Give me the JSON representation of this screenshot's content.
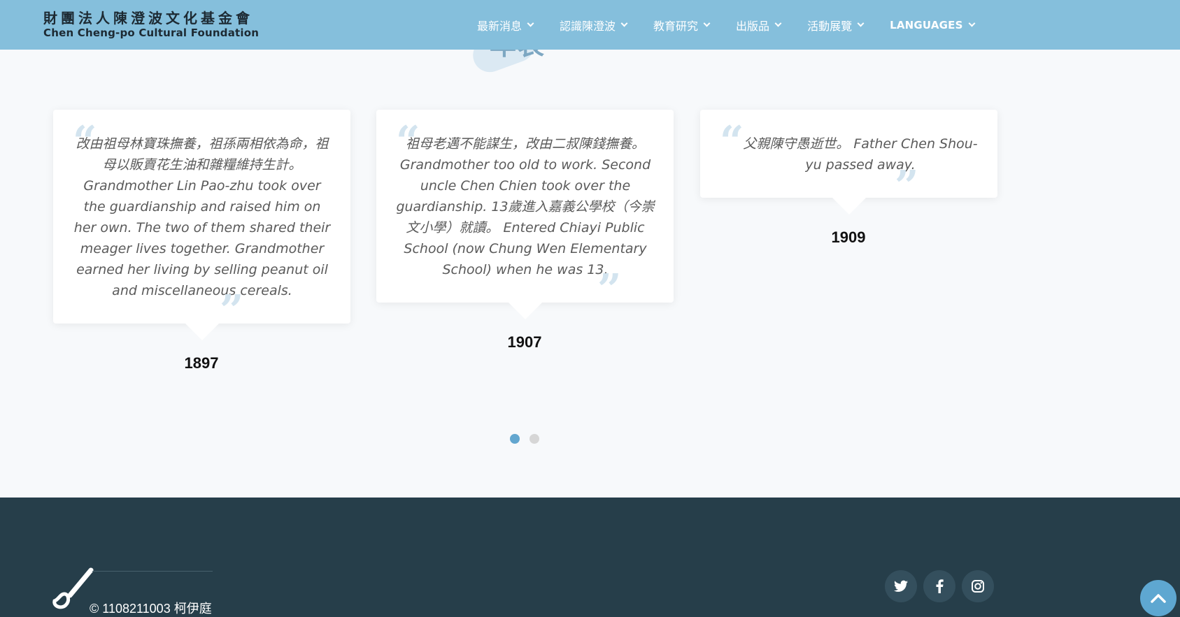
{
  "logo": {
    "name_cn": "財團法人陳澄波文化基金會",
    "name_en": "Chen Cheng-po Cultural Foundation"
  },
  "nav": {
    "items": [
      {
        "label": "最新消息"
      },
      {
        "label": "認識陳澄波"
      },
      {
        "label": "教育研究"
      },
      {
        "label": "出版品"
      },
      {
        "label": "活動展覽"
      },
      {
        "label": "LANGUAGES"
      }
    ]
  },
  "section": {
    "title": "年表"
  },
  "timeline": [
    {
      "text": "改由祖母林寶珠撫養，祖孫兩相依為命，祖母以販賣花生油和雜糧維持生計。 Grandmother Lin Pao-zhu took over the guardianship and raised him on her own. The two of them shared their meager lives together. Grandmother earned her living by selling peanut oil and miscellaneous cereals.",
      "year": "1897"
    },
    {
      "text": "祖母老邁不能謀生，改由二叔陳錢撫養。 Grandmother too old to work. Second uncle Chen Chien took over the guardianship. 13歲進入嘉義公學校（今崇文小學）就讀。 Entered Chiayi Public School (now Chung Wen Elementary School) when he was 13.",
      "year": "1907"
    },
    {
      "text": "父親陳守愚逝世。 Father Chen Shou-yu passed away.",
      "year": "1909"
    }
  ],
  "pagination": {
    "total_pages": 2,
    "active_page": 1
  },
  "footer": {
    "copyright": "© 1108211003 柯伊庭",
    "social": [
      "twitter-icon",
      "facebook-icon",
      "instagram-icon"
    ]
  },
  "colors": {
    "header_bg": "#85bfdc",
    "footer_bg": "#263e4a",
    "accent": "#5ea7d1"
  }
}
